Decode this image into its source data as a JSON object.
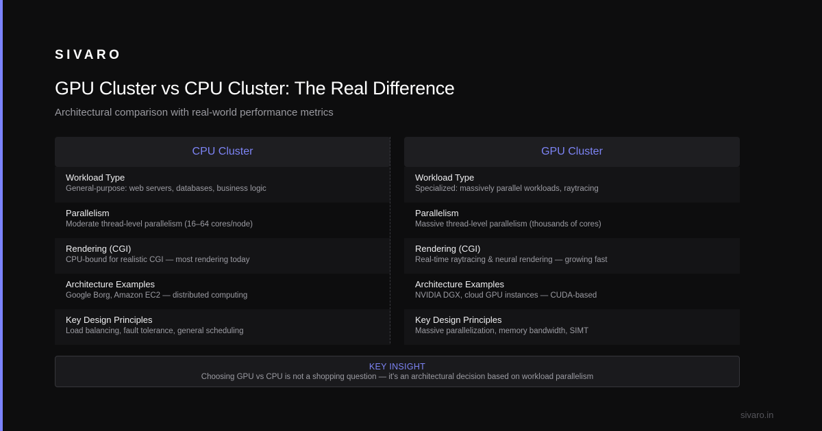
{
  "brand": "SIVARO",
  "title": "GPU Cluster vs CPU Cluster: The Real Difference",
  "subtitle": "Architectural comparison with real-world performance metrics",
  "columns": [
    {
      "header": "CPU Cluster",
      "rows": [
        {
          "label": "Workload Type",
          "value": "General-purpose: web servers, databases, business logic"
        },
        {
          "label": "Parallelism",
          "value": "Moderate thread-level parallelism (16–64 cores/node)"
        },
        {
          "label": "Rendering (CGI)",
          "value": "CPU-bound for realistic CGI — most rendering today"
        },
        {
          "label": "Architecture Examples",
          "value": "Google Borg, Amazon EC2 — distributed computing"
        },
        {
          "label": "Key Design Principles",
          "value": "Load balancing, fault tolerance, general scheduling"
        }
      ]
    },
    {
      "header": "GPU Cluster",
      "rows": [
        {
          "label": "Workload Type",
          "value": "Specialized: massively parallel workloads, raytracing"
        },
        {
          "label": "Parallelism",
          "value": "Massive thread-level parallelism (thousands of cores)"
        },
        {
          "label": "Rendering (CGI)",
          "value": "Real-time raytracing & neural rendering — growing fast"
        },
        {
          "label": "Architecture Examples",
          "value": "NVIDIA DGX, cloud GPU instances — CUDA-based"
        },
        {
          "label": "Key Design Principles",
          "value": "Massive parallelization, memory bandwidth, SIMT"
        }
      ]
    }
  ],
  "insight": {
    "title": "KEY INSIGHT",
    "text": "Choosing GPU vs CPU is not a shopping question — it's an architectural decision based on workload parallelism"
  },
  "footer": "sivaro.in",
  "colors": {
    "accent": "#7b83ff",
    "background": "#0d0d0e",
    "header_text": "#7d84f5"
  }
}
